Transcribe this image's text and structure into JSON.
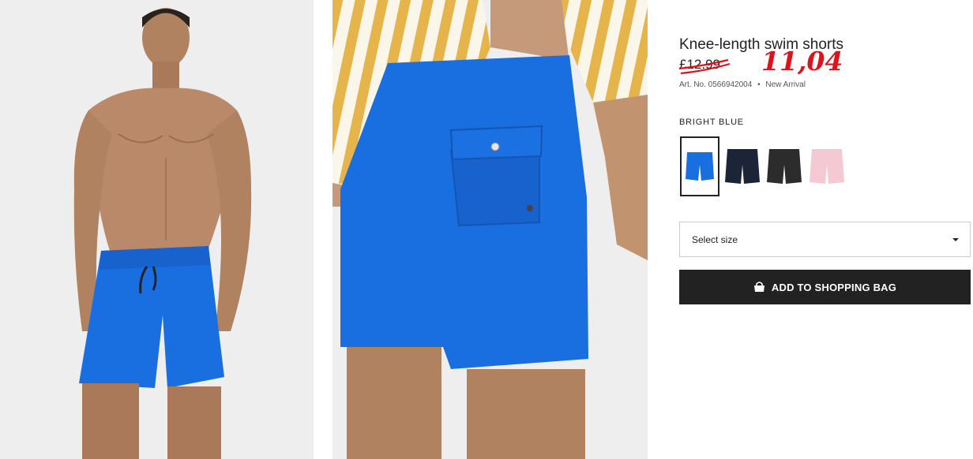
{
  "product": {
    "title": "Knee-length swim shorts",
    "old_price": "£12.99",
    "new_price": "11,04",
    "art_no": "Art. No. 0566942004",
    "dot": "•",
    "badge": "New Arrival",
    "color_name": "BRIGHT BLUE"
  },
  "swatches": [
    {
      "name": "bright-blue",
      "color": "#1a6fe0",
      "selected": true
    },
    {
      "name": "navy",
      "color": "#1c2538",
      "selected": false
    },
    {
      "name": "dark-grey",
      "color": "#2c2c2c",
      "selected": false
    },
    {
      "name": "light-pink",
      "color": "#f5c9d4",
      "selected": false
    }
  ],
  "size_select": {
    "label": "Select size"
  },
  "cart": {
    "label": "ADD TO SHOPPING BAG",
    "icon": "shopping-bag-icon"
  },
  "colors": {
    "shorts_blue": "#1a6fe0",
    "button_bg": "#222222",
    "price_red": "#e1111a",
    "photo_bg": "#eeeeee"
  }
}
